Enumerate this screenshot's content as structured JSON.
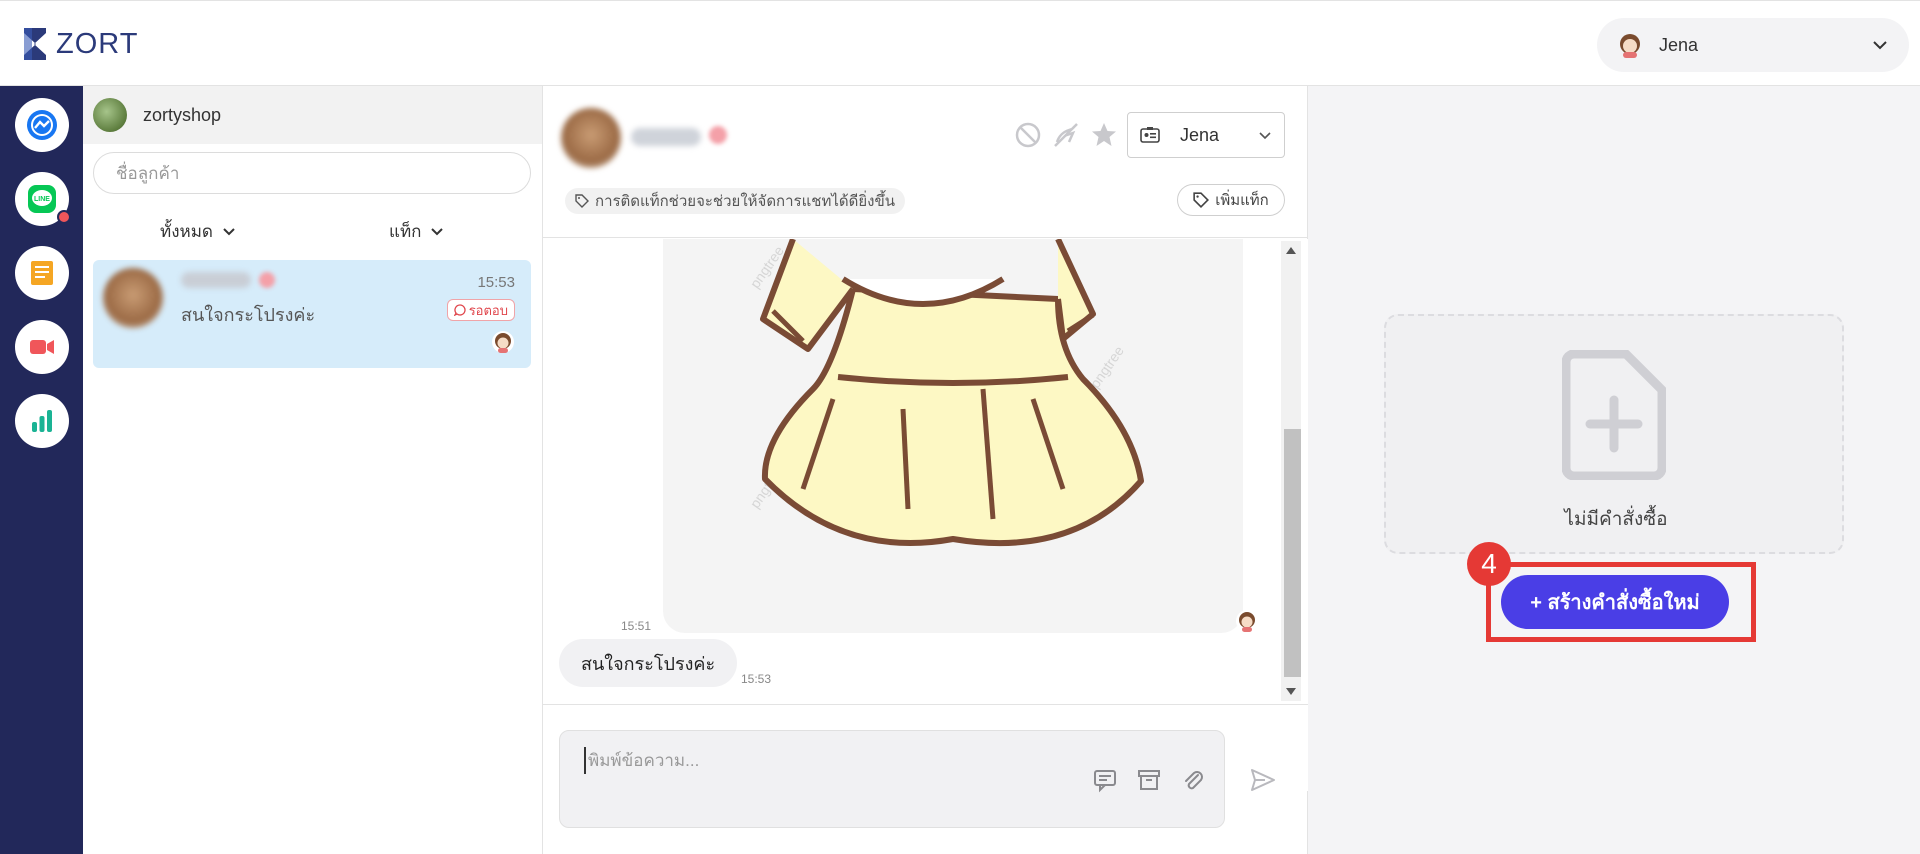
{
  "app": {
    "logo_text": "ZORT"
  },
  "user_menu": {
    "name": "Jena"
  },
  "rail": {
    "items": [
      {
        "name": "messenger-icon",
        "color": "#1877f2"
      },
      {
        "name": "line-icon",
        "color": "#06c755",
        "has_notification": true
      },
      {
        "name": "notes-icon",
        "color": "#f5a623"
      },
      {
        "name": "video-icon",
        "color": "#f0565a"
      },
      {
        "name": "analytics-icon",
        "color": "#1ab394"
      }
    ]
  },
  "contacts": {
    "shop_name": "zortyshop",
    "search_placeholder": "ชื่อลูกค้า",
    "filter_all": "ทั้งหมด",
    "filter_tag": "แท็ก",
    "conversations": [
      {
        "message": "สนใจกระโปรงค่ะ",
        "time": "15:53",
        "status": "รอตอบ"
      }
    ]
  },
  "chat": {
    "assignee": "Jena",
    "tag_hint": "การติดแท็กช่วยจะช่วยให้จัดการแชทได้ดียิ่งขึ้น",
    "add_tag": "เพิ่มแท็ก",
    "messages": [
      {
        "type": "image",
        "time": "15:51",
        "watermark": "pngtree"
      },
      {
        "type": "text",
        "text": "สนใจกระโปรงค่ะ",
        "time": "15:53"
      }
    ],
    "composer_placeholder": "พิมพ์ข้อความ..."
  },
  "orders": {
    "empty_text": "ไม่มีคำสั่งซื้อ",
    "create_button": "+ สร้างคำสั่งซื้อใหม่",
    "step_number": "4",
    "accent": "#4a3ee6",
    "highlight_color": "#e53935"
  }
}
